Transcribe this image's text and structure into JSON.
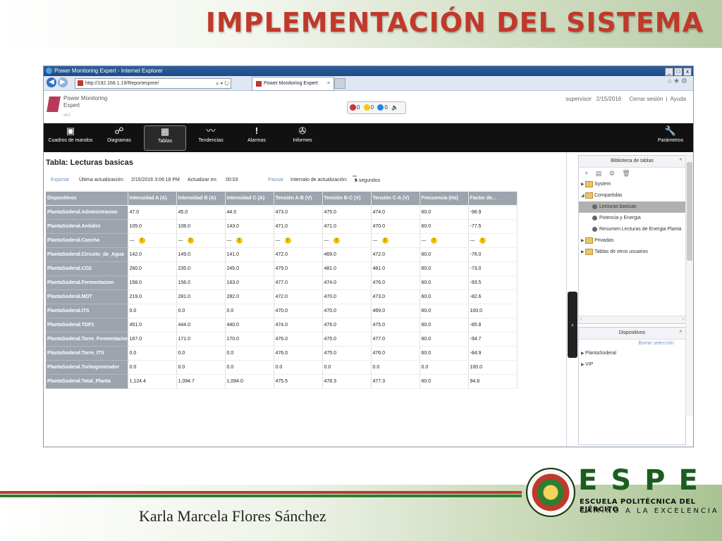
{
  "slide": {
    "title": "IMPLEMENTACIÓN DEL SISTEMA",
    "author": "Karla Marcela Flores Sánchez",
    "logo_text": "ESPE",
    "logo_sub1": "ESCUELA POLITÉCNICA DEL EJÉRCITO",
    "logo_sub2": "CAMINO A LA EXCELENCIA",
    "colors": {
      "title": "#c0392b",
      "brand_green": "#1b5e20",
      "stripe_red": "#c0392b",
      "stripe_green": "#2e7d32"
    }
  },
  "browser": {
    "window_title": "Power Monitoring Expert - Internet Explorer",
    "address": "http://192.168.1.19/Reportespme/",
    "tab_label": "Power Monitoring Expert",
    "window_buttons": [
      "_",
      "□",
      "x"
    ]
  },
  "app": {
    "name": "Power Monitoring Expert",
    "version": "v8.0",
    "alarm_counts": {
      "red": "0",
      "yellow": "0",
      "blue": "0"
    },
    "user": "supervisor",
    "date": "2/15/2016",
    "logout": "Cerrar sesión",
    "help": "Ayuda",
    "toolbar": [
      {
        "label": "Cuadros de mandos",
        "icon": "dashboard-icon",
        "glyph": "▣"
      },
      {
        "label": "Diagramas",
        "icon": "diagram-icon",
        "glyph": "☍"
      },
      {
        "label": "Tablas",
        "icon": "table-icon",
        "glyph": "▦",
        "active": true
      },
      {
        "label": "Tendencias",
        "icon": "trend-icon",
        "glyph": "〰"
      },
      {
        "label": "Alarmas",
        "icon": "alarm-icon",
        "glyph": "!"
      },
      {
        "label": "Informes",
        "icon": "report-icon",
        "glyph": "✇"
      }
    ],
    "settings_label": "Parámetros"
  },
  "report": {
    "title": "Tabla: Lecturas basicas",
    "export": "Exportar",
    "last_update_label": "Última actualización:",
    "last_update": "2/15/2016 3:06:18 PM",
    "refresh_in_label": "Actualizar en:",
    "refresh_in": "00:03",
    "pause": "Pausar",
    "interval_label": "Intervalo de actualización:",
    "interval": "5 segundos",
    "columns": [
      "Dispositivos",
      "Intensidad A (A)",
      "Intensidad B (A)",
      "Intensidad C (A)",
      "Tensión A-B (V)",
      "Tensión B-C (V)",
      "Tensión C-A (V)",
      "Frecuencia (Hz)",
      "Factor de..."
    ],
    "rows": [
      [
        "PlantaSoderal.Administracion",
        "47.0",
        "45.0",
        "44.0",
        "473.0",
        "475.0",
        "474.0",
        "60.0",
        "-96.9"
      ],
      [
        "PlantaSoderal.Anhidro",
        "105.0",
        "108.0",
        "143.0",
        "471.0",
        "471.0",
        "470.0",
        "60.0",
        "-77.5"
      ],
      [
        "PlantaSoderal.Cancha",
        "---",
        "---",
        "---",
        "---",
        "---",
        "---",
        "---",
        "---"
      ],
      [
        "PlantaSoderal.Circuito_de_Agua",
        "142.0",
        "149.0",
        "141.0",
        "472.0",
        "469.0",
        "472.0",
        "60.0",
        "-76.0"
      ],
      [
        "PlantaSoderal.CO2",
        "260.0",
        "235.0",
        "245.0",
        "479.0",
        "481.0",
        "481.0",
        "60.0",
        "-73.0"
      ],
      [
        "PlantaSoderal.Fermentacion",
        "158.0",
        "156.0",
        "163.0",
        "477.0",
        "474.0",
        "476.0",
        "60.0",
        "-93.5"
      ],
      [
        "PlantaSoderal.MDT",
        "219.0",
        "281.0",
        "282.0",
        "472.0",
        "470.0",
        "473.0",
        "60.0",
        "-82.6"
      ],
      [
        "PlantaSoderal.ITS",
        "0.0",
        "0.0",
        "0.0",
        "470.0",
        "470.0",
        "469.0",
        "60.0",
        "100.0"
      ],
      [
        "PlantaSoderal.TDP1",
        "451.0",
        "444.0",
        "440.0",
        "474.0",
        "476.0",
        "475.0",
        "60.0",
        "-85.8"
      ],
      [
        "PlantaSoderal.Torre_Fermentacion",
        "167.0",
        "171.0",
        "170.0",
        "476.0",
        "475.0",
        "477.0",
        "60.0",
        "-94.7"
      ],
      [
        "PlantaSoderal.Torre_ITS",
        "0.0",
        "0.0",
        "0.0",
        "476.0",
        "475.0",
        "476.0",
        "60.0",
        "-84.9"
      ],
      [
        "PlantaSoderal.Turbogenerador",
        "0.0",
        "0.0",
        "0.0",
        "0.0",
        "0.0",
        "0.0",
        "0.0",
        "100.0"
      ],
      [
        "PlantaSoderal.Total_Planta",
        "1,124.4",
        "1,094.7",
        "1,094.0",
        "475.5",
        "478.3",
        "477.3",
        "60.0",
        "94.8"
      ]
    ],
    "warning_row": 2
  },
  "library": {
    "title": "Biblioteca de tablas",
    "tools": "+ ▤ ⚙ 🗑",
    "tree": [
      {
        "label": "System",
        "level": 0,
        "type": "folder",
        "toggle": "▶"
      },
      {
        "label": "Compartidas",
        "level": 0,
        "type": "folder",
        "toggle": "◢"
      },
      {
        "label": "Lecturas basicas",
        "level": 1,
        "type": "report",
        "selected": true
      },
      {
        "label": "Potencia y Energia",
        "level": 1,
        "type": "report"
      },
      {
        "label": "Resumen Lecturas de Energia Planta",
        "level": 1,
        "type": "report"
      },
      {
        "label": "Privadas",
        "level": 0,
        "type": "folder",
        "toggle": "▶"
      },
      {
        "label": "Tablas de otros usuarios",
        "level": 0,
        "type": "folder",
        "toggle": "▶"
      }
    ]
  },
  "devices": {
    "title": "Dispositivos",
    "clear": "Borrar selección",
    "items": [
      "PlantaSoderal",
      "VIP"
    ]
  }
}
